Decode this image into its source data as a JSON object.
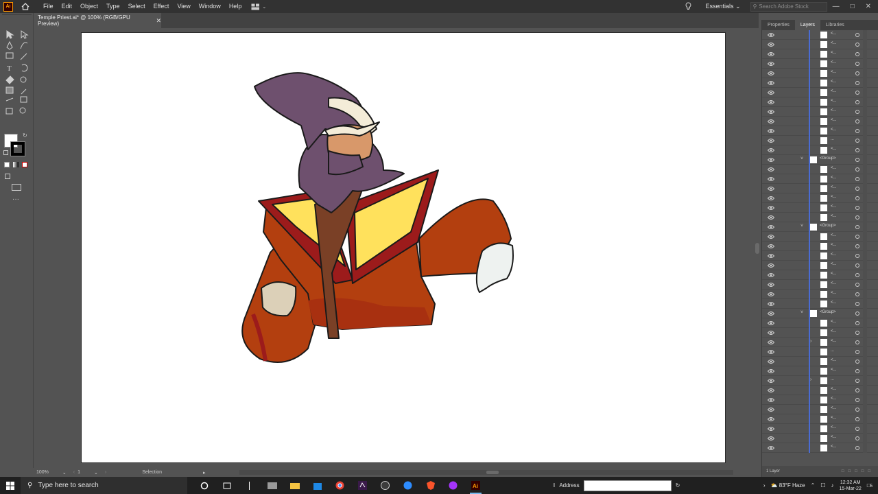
{
  "app": {
    "logo": "Ai",
    "menu": [
      "File",
      "Edit",
      "Object",
      "Type",
      "Select",
      "Effect",
      "View",
      "Window",
      "Help"
    ],
    "workspace": "Essentials",
    "search_placeholder": "Search Adobe Stock"
  },
  "document": {
    "tab_title": "Temple Priest.ai* @ 100% (RGB/GPU Preview)",
    "zoom": "100%",
    "artboard_number": "1",
    "status": "Selection"
  },
  "panel": {
    "tabs": [
      "Properties",
      "Layers",
      "Libraries"
    ],
    "active_tab": "Layers",
    "footer": "1 Layer",
    "group_label": "<Group>",
    "item_label": "<...",
    "short_label": "..."
  },
  "taskbar": {
    "search_placeholder": "Type here to search",
    "address_label": "Address",
    "weather": "83°F  Haze",
    "time": "12:32 AM",
    "date": "15-Mar-22",
    "notifications": "5"
  },
  "colors": {
    "accent": "#4a6cd4",
    "ui_dark": "#323232",
    "ui_mid": "#535353",
    "robe": "#b33f0f",
    "robe_trim": "#9c1b1b",
    "collar": "#ffe15c",
    "hood": "#6e506e"
  }
}
